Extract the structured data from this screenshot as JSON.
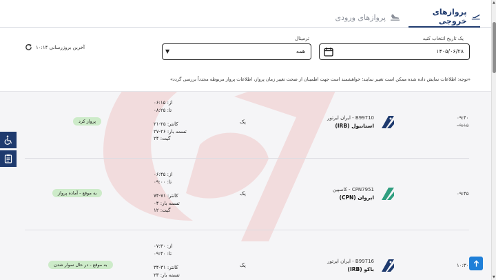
{
  "tabs": {
    "departures": "پروازهای خروجی",
    "arrivals": "پروازهای ورودی"
  },
  "filters": {
    "date_label": "یک تاریخ انتخاب کنید",
    "date_value": "۱۴۰۵/۰۶/۲۸",
    "terminal_label": "ترمینال",
    "terminal_value": "همه",
    "last_update": "آخرین بروزرسانی ۱۰:۱۴"
  },
  "notice": "«توجه: اطلاعات نمایش داده شده ممکن است تغییر نمایند؛ خواهشمند است جهت اطمینان از صحت تغییر زمان پرواز، اطلاعات پرواز مربوطه مجدداً بررسی گردد»",
  "flights": [
    {
      "time": "۰۹:۴۰",
      "time_old": "۰۹:۱۵",
      "flight": "B99710 - ایران ایرتور",
      "destination": "استانبول (IRB)",
      "class": "یک",
      "from": "از: ۰۶:۱۵",
      "to": "تا: ۰۸:۲۵",
      "counter": "کانتر: ۲۵-۲۱",
      "baggage": "تسمه بار: ۲۶-۲۷",
      "gate": "گیت: ۲۴",
      "status": "پرواز کرد",
      "logo_color": "#1e3a6e"
    },
    {
      "time": "۰۹:۴۵",
      "time_old": "",
      "flight": "CPN7951 - کاسپین",
      "destination": "ایروان (CPN)",
      "class": "یک",
      "from": "از: ۰۶:۴۵",
      "to": "تا: ۰۹:۰۰",
      "counter": "کانتر: ۷۱-۷۴",
      "baggage": "تسمه بار: ۰۴",
      "gate": "گیت: ۱۲",
      "status": "به موقع - آماده پرواز",
      "logo_color": "#2f9e7f"
    },
    {
      "time": "۱۰:۳۰",
      "time_old": "",
      "flight": "B99716 - ایران ایرتور",
      "destination": "باکو (IRB)",
      "class": "یک",
      "from": "از: ۰۷:۳۰",
      "to": "تا: ۰۹:۴۰",
      "counter": "کانتر: ۳۱-۳۴",
      "baggage": "تسمه بار: ۲۳",
      "gate": "",
      "status": "به موقع - در حال سوار شدن",
      "logo_color": "#1e3a6e"
    }
  ],
  "colors": {
    "brand": "#1e3a6e",
    "status_bg": "#cdebc9",
    "watermark": "#e53935",
    "to_top": "#1f7fd8"
  },
  "icons": {
    "departure": "plane-departure-icon",
    "arrival": "plane-arrival-icon",
    "calendar": "calendar-icon",
    "refresh": "refresh-icon",
    "accessibility": "wheelchair-icon",
    "clipboard": "clipboard-icon",
    "to_top": "arrow-up-icon"
  }
}
